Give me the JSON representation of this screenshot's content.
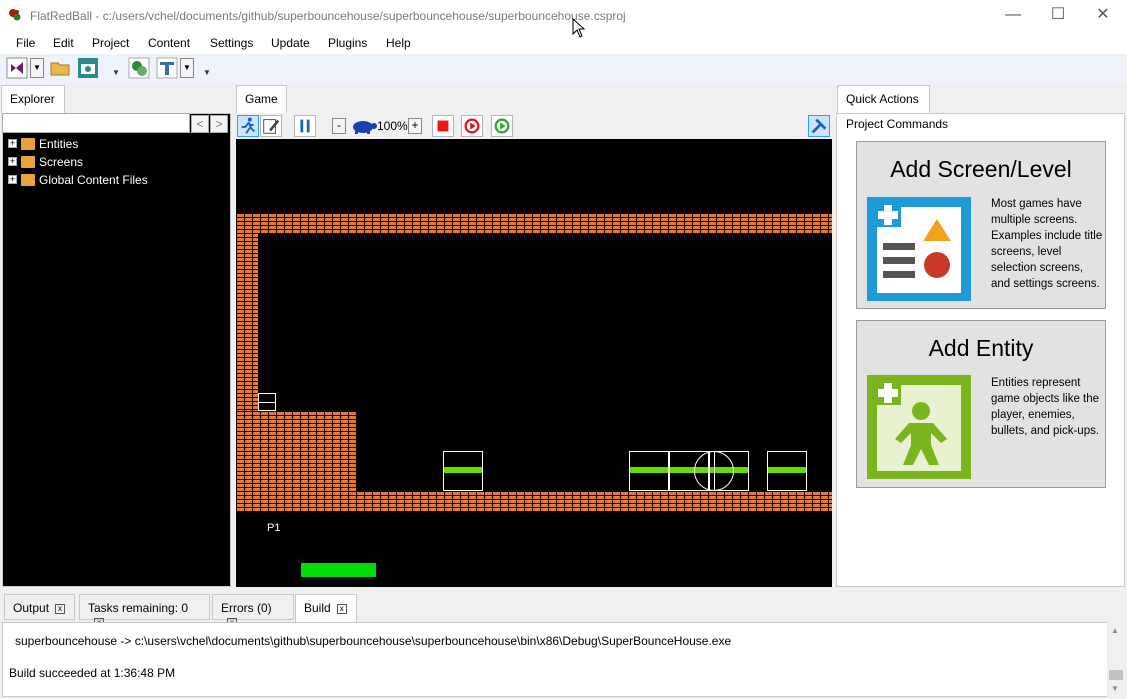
{
  "window": {
    "title": "FlatRedBall - c:/users/vchel/documents/github/superbouncehouse/superbouncehouse/superbouncehouse.csproj",
    "minimize_glyph": "—",
    "maximize_glyph": "☐",
    "close_glyph": "✕"
  },
  "menu": [
    "File",
    "Edit",
    "Project",
    "Content",
    "Settings",
    "Update",
    "Plugins",
    "Help"
  ],
  "explorer": {
    "tab_label": "Explorer",
    "search_placeholder": "",
    "back_glyph": "<",
    "forward_glyph": ">",
    "tree": [
      {
        "label": "Entities"
      },
      {
        "label": "Screens"
      },
      {
        "label": "Global Content Files"
      }
    ]
  },
  "game": {
    "tab_label": "Game",
    "zoom_minus": "-",
    "zoom_plus": "+",
    "zoom_level": "100%",
    "player_label": "P1"
  },
  "quick_actions": {
    "tab_label": "Quick Actions",
    "section_label": "Project Commands",
    "cards": [
      {
        "title": "Add Screen/Level",
        "description": "Most games have multiple screens. Examples include title screens, level selection screens, and settings screens."
      },
      {
        "title": "Add Entity",
        "description": "Entities represent game objects like the player, enemies, bullets, and pick-ups."
      }
    ]
  },
  "bottom": {
    "tabs": [
      {
        "label": "Output",
        "active": false
      },
      {
        "label": "Tasks remaining: 0",
        "active": false
      },
      {
        "label": "Errors (0)",
        "active": false
      },
      {
        "label": "Build",
        "active": true
      }
    ],
    "close_glyph": "x",
    "output_lines": [
      "superbouncehouse -> c:\\users\\vchel\\documents\\github\\superbouncehouse\\superbouncehouse\\bin\\x86\\Debug\\SuperBounceHouse.exe",
      "Build succeeded at 1:36:48 PM"
    ]
  },
  "colors": {
    "brick": "#e8782e",
    "player_bar": "#00dd00",
    "platform_stripe": "#66dd00",
    "screen_icon_bg": "#1e9bd7",
    "entity_icon_bg": "#7ab51d"
  }
}
